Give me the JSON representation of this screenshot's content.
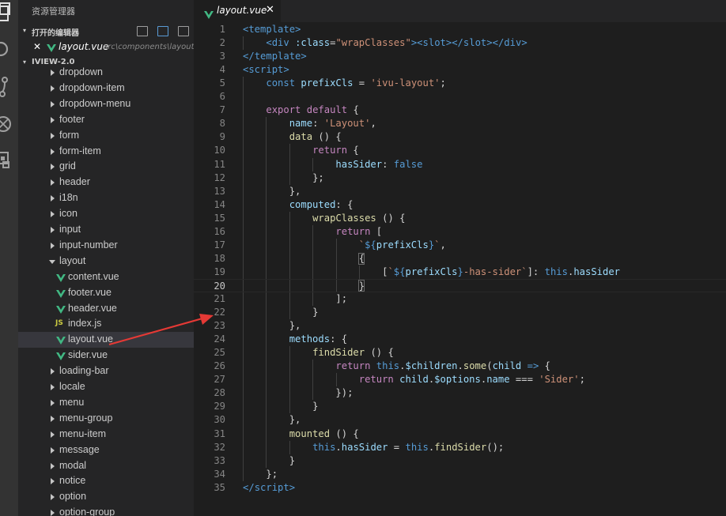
{
  "explorer": {
    "title": "资源管理器",
    "open_editors_label": "打开的编辑器",
    "open_editor": {
      "close": "✕",
      "name": "layout.vue",
      "path": "src\\components\\layout"
    },
    "project_label": "IVIEW-2.0"
  },
  "tree": [
    {
      "label": "dropdown",
      "type": "folder"
    },
    {
      "label": "dropdown-item",
      "type": "folder"
    },
    {
      "label": "dropdown-menu",
      "type": "folder"
    },
    {
      "label": "footer",
      "type": "folder"
    },
    {
      "label": "form",
      "type": "folder"
    },
    {
      "label": "form-item",
      "type": "folder"
    },
    {
      "label": "grid",
      "type": "folder"
    },
    {
      "label": "header",
      "type": "folder"
    },
    {
      "label": "i18n",
      "type": "folder"
    },
    {
      "label": "icon",
      "type": "folder"
    },
    {
      "label": "input",
      "type": "folder"
    },
    {
      "label": "input-number",
      "type": "folder"
    },
    {
      "label": "layout",
      "type": "folder-open"
    },
    {
      "label": "content.vue",
      "type": "vue"
    },
    {
      "label": "footer.vue",
      "type": "vue"
    },
    {
      "label": "header.vue",
      "type": "vue"
    },
    {
      "label": "index.js",
      "type": "js",
      "badge": "JS"
    },
    {
      "label": "layout.vue",
      "type": "vue",
      "selected": true
    },
    {
      "label": "sider.vue",
      "type": "vue"
    },
    {
      "label": "loading-bar",
      "type": "folder"
    },
    {
      "label": "locale",
      "type": "folder"
    },
    {
      "label": "menu",
      "type": "folder"
    },
    {
      "label": "menu-group",
      "type": "folder"
    },
    {
      "label": "menu-item",
      "type": "folder"
    },
    {
      "label": "message",
      "type": "folder"
    },
    {
      "label": "modal",
      "type": "folder"
    },
    {
      "label": "notice",
      "type": "folder"
    },
    {
      "label": "option",
      "type": "folder"
    },
    {
      "label": "option-group",
      "type": "folder"
    }
  ],
  "tab": {
    "name": "layout.vue",
    "close": "✕"
  },
  "editor": {
    "current_line": 20,
    "lines": [
      [
        [
          "<",
          "t-tag"
        ],
        [
          "template",
          "t-tag"
        ],
        [
          ">",
          "t-tag"
        ]
      ],
      [
        [
          "    ",
          "t-pun"
        ],
        [
          "<",
          "t-tag"
        ],
        [
          "div",
          "t-tag"
        ],
        [
          " ",
          "t-pun"
        ],
        [
          ":class",
          "t-attr"
        ],
        [
          "=",
          "t-pun"
        ],
        [
          "\"wrapClasses\"",
          "t-str"
        ],
        [
          ">",
          "t-tag"
        ],
        [
          "<",
          "t-tag"
        ],
        [
          "slot",
          "t-tag"
        ],
        [
          ">",
          "t-tag"
        ],
        [
          "</",
          "t-tag"
        ],
        [
          "slot",
          "t-tag"
        ],
        [
          ">",
          "t-tag"
        ],
        [
          "</",
          "t-tag"
        ],
        [
          "div",
          "t-tag"
        ],
        [
          ">",
          "t-tag"
        ]
      ],
      [
        [
          "</",
          "t-tag"
        ],
        [
          "template",
          "t-tag"
        ],
        [
          ">",
          "t-tag"
        ]
      ],
      [
        [
          "<",
          "t-tag"
        ],
        [
          "script",
          "t-tag"
        ],
        [
          ">",
          "t-tag"
        ]
      ],
      [
        [
          "    ",
          "t-pun"
        ],
        [
          "const",
          "t-kw"
        ],
        [
          " ",
          "t-pun"
        ],
        [
          "prefixCls",
          "t-var"
        ],
        [
          " = ",
          "t-pun"
        ],
        [
          "'ivu-layout'",
          "t-str"
        ],
        [
          ";",
          "t-pun"
        ]
      ],
      [],
      [
        [
          "    ",
          "t-pun"
        ],
        [
          "export",
          "t-ctl"
        ],
        [
          " ",
          "t-pun"
        ],
        [
          "default",
          "t-ctl"
        ],
        [
          " {",
          "t-pun"
        ]
      ],
      [
        [
          "        ",
          "t-pun"
        ],
        [
          "name",
          "t-var"
        ],
        [
          ": ",
          "t-pun"
        ],
        [
          "'Layout'",
          "t-str"
        ],
        [
          ",",
          "t-pun"
        ]
      ],
      [
        [
          "        ",
          "t-pun"
        ],
        [
          "data",
          "t-fn"
        ],
        [
          " () {",
          "t-pun"
        ]
      ],
      [
        [
          "            ",
          "t-pun"
        ],
        [
          "return",
          "t-ctl"
        ],
        [
          " {",
          "t-pun"
        ]
      ],
      [
        [
          "                ",
          "t-pun"
        ],
        [
          "hasSider",
          "t-var"
        ],
        [
          ": ",
          "t-pun"
        ],
        [
          "false",
          "t-kw"
        ]
      ],
      [
        [
          "            ",
          "t-pun"
        ],
        [
          "};",
          "t-pun"
        ]
      ],
      [
        [
          "        ",
          "t-pun"
        ],
        [
          "},",
          "t-pun"
        ]
      ],
      [
        [
          "        ",
          "t-pun"
        ],
        [
          "computed",
          "t-var"
        ],
        [
          ": {",
          "t-pun"
        ]
      ],
      [
        [
          "            ",
          "t-pun"
        ],
        [
          "wrapClasses",
          "t-fn"
        ],
        [
          " () {",
          "t-pun"
        ]
      ],
      [
        [
          "                ",
          "t-pun"
        ],
        [
          "return",
          "t-ctl"
        ],
        [
          " [",
          "t-pun"
        ]
      ],
      [
        [
          "                    ",
          "t-pun"
        ],
        [
          "`",
          "t-str"
        ],
        [
          "${",
          "t-tpl"
        ],
        [
          "prefixCls",
          "t-var"
        ],
        [
          "}",
          "t-tpl"
        ],
        [
          "`",
          "t-str"
        ],
        [
          ",",
          "t-pun"
        ]
      ],
      [
        [
          "                    ",
          "t-pun"
        ],
        [
          "{",
          "t-pun"
        ]
      ],
      [
        [
          "                        ",
          "t-pun"
        ],
        [
          "[",
          "t-pun"
        ],
        [
          "`",
          "t-str"
        ],
        [
          "${",
          "t-tpl"
        ],
        [
          "prefixCls",
          "t-var"
        ],
        [
          "}",
          "t-tpl"
        ],
        [
          "-has-sider`",
          "t-str"
        ],
        [
          "]: ",
          "t-pun"
        ],
        [
          "this",
          "t-kw"
        ],
        [
          ".",
          "t-pun"
        ],
        [
          "hasSider",
          "t-var"
        ]
      ],
      [
        [
          "                    ",
          "t-pun"
        ],
        [
          "}",
          "t-pun"
        ]
      ],
      [
        [
          "                ",
          "t-pun"
        ],
        [
          "];",
          "t-pun"
        ]
      ],
      [
        [
          "            ",
          "t-pun"
        ],
        [
          "}",
          "t-pun"
        ]
      ],
      [
        [
          "        ",
          "t-pun"
        ],
        [
          "},",
          "t-pun"
        ]
      ],
      [
        [
          "        ",
          "t-pun"
        ],
        [
          "methods",
          "t-var"
        ],
        [
          ": {",
          "t-pun"
        ]
      ],
      [
        [
          "            ",
          "t-pun"
        ],
        [
          "findSider",
          "t-fn"
        ],
        [
          " () {",
          "t-pun"
        ]
      ],
      [
        [
          "                ",
          "t-pun"
        ],
        [
          "return",
          "t-ctl"
        ],
        [
          " ",
          "t-pun"
        ],
        [
          "this",
          "t-kw"
        ],
        [
          ".",
          "t-pun"
        ],
        [
          "$children",
          "t-var"
        ],
        [
          ".",
          "t-pun"
        ],
        [
          "some",
          "t-fn"
        ],
        [
          "(",
          "t-pun"
        ],
        [
          "child",
          "t-var"
        ],
        [
          " ",
          "t-pun"
        ],
        [
          "=>",
          "t-kw"
        ],
        [
          " {",
          "t-pun"
        ]
      ],
      [
        [
          "                    ",
          "t-pun"
        ],
        [
          "return",
          "t-ctl"
        ],
        [
          " ",
          "t-pun"
        ],
        [
          "child",
          "t-var"
        ],
        [
          ".",
          "t-pun"
        ],
        [
          "$options",
          "t-var"
        ],
        [
          ".",
          "t-pun"
        ],
        [
          "name",
          "t-var"
        ],
        [
          " === ",
          "t-pun"
        ],
        [
          "'Sider'",
          "t-str"
        ],
        [
          ";",
          "t-pun"
        ]
      ],
      [
        [
          "                ",
          "t-pun"
        ],
        [
          "});",
          "t-pun"
        ]
      ],
      [
        [
          "            ",
          "t-pun"
        ],
        [
          "}",
          "t-pun"
        ]
      ],
      [
        [
          "        ",
          "t-pun"
        ],
        [
          "},",
          "t-pun"
        ]
      ],
      [
        [
          "        ",
          "t-pun"
        ],
        [
          "mounted",
          "t-fn"
        ],
        [
          " () {",
          "t-pun"
        ]
      ],
      [
        [
          "            ",
          "t-pun"
        ],
        [
          "this",
          "t-kw"
        ],
        [
          ".",
          "t-pun"
        ],
        [
          "hasSider",
          "t-var"
        ],
        [
          " = ",
          "t-pun"
        ],
        [
          "this",
          "t-kw"
        ],
        [
          ".",
          "t-pun"
        ],
        [
          "findSider",
          "t-fn"
        ],
        [
          "();",
          "t-pun"
        ]
      ],
      [
        [
          "        ",
          "t-pun"
        ],
        [
          "}",
          "t-pun"
        ]
      ],
      [
        [
          "    ",
          "t-pun"
        ],
        [
          "};",
          "t-pun"
        ]
      ],
      [
        [
          "</",
          "t-tag"
        ],
        [
          "script",
          "t-tag"
        ],
        [
          ">",
          "t-tag"
        ]
      ]
    ]
  },
  "colors": {
    "vue_icon": "#41b883",
    "annotation_arrow": "#e53935"
  }
}
